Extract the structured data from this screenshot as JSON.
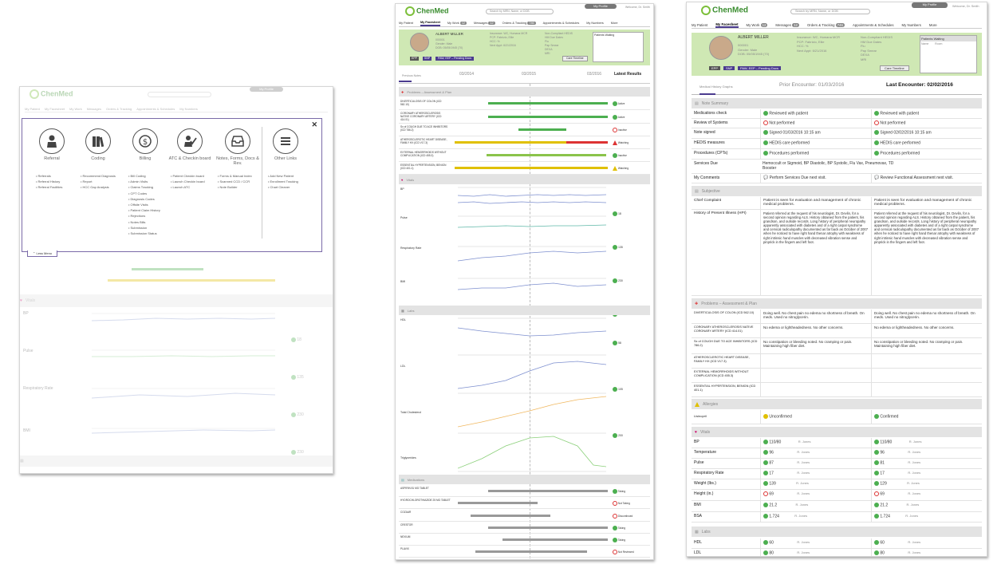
{
  "brand": {
    "logo_text": "ChenMed",
    "green": "#3a8d2f",
    "accent": "#4b3b8f"
  },
  "header": {
    "my_profile": "My Profile",
    "welcome": "Welcome, Dr. Smith",
    "sign_out": "Sign out",
    "search_placeholder": "Search by MRN, Name, or DOB"
  },
  "nav": {
    "tabs": [
      {
        "label": "My Patient"
      },
      {
        "label": "My Facesheet"
      },
      {
        "label": "My Work",
        "count": "12"
      },
      {
        "label": "Messages",
        "count": "12"
      },
      {
        "label": "Orders & Tracking",
        "count": "746"
      },
      {
        "label": "Appointments & Schedules"
      },
      {
        "label": "My Numbers"
      },
      {
        "label": "More"
      }
    ]
  },
  "menu_overlay": {
    "columns": [
      {
        "title": "Referral",
        "icon": "person-icon",
        "links": [
          "Referrals",
          "Referral History",
          "Referral Facilities"
        ]
      },
      {
        "title": "Coding",
        "icon": "books-icon",
        "links": [
          "Recommend Diagnosis",
          "Report",
          "HCC Gap Analysis"
        ]
      },
      {
        "title": "Billing",
        "icon": "dollar-icon",
        "links": [
          "Bill Coding",
          "Admin Visits",
          "Claims Tracking",
          "CPT Codes",
          "Diagnosis Codes",
          "Offsite Visits",
          "Patient Claim History",
          "Rejections",
          "Notes Bills",
          "Submission",
          "Submission Status"
        ]
      },
      {
        "title": "ATC & Checkin board",
        "icon": "checkin-icon",
        "links": [
          "Patient Checkin board",
          "Launch Checkin board",
          "Launch ATC"
        ]
      },
      {
        "title": "Notes, Forms, Docs & Rev.",
        "icon": "inbox-icon",
        "links": [
          "Forms & Manual Index",
          "Scanned CCD / CCR",
          "Note Builder"
        ]
      },
      {
        "title": "Other Links",
        "icon": "hamburger-icon",
        "links": [
          "Add New Patient",
          "Enrollment Tracking",
          "Chart Cleaner"
        ]
      }
    ],
    "less_menu": "Less Menu",
    "close": "✕"
  },
  "patient": {
    "name": "ALBERT MILLER",
    "id": "000001",
    "gender_label": "Gender:",
    "gender": "Male",
    "dob_label": "DOB:",
    "dob": "05/05/1945 (70)",
    "insurance_label": "Insurance:",
    "insurance": "WC, Humana MCR",
    "pcp_label": "PCP:",
    "pcp": "Fabrizio, Ellie",
    "hcc_label": "HCC:",
    "hcc": "%",
    "next_appt_label": "Next Appt:",
    "next_appt": "6/21/2016",
    "hedis_title": "Non-Compliant HEDIS",
    "hedis_items": [
      "HM Due Dates",
      "Flu",
      "Pap Smear",
      "DEXA",
      "MRI"
    ],
    "waiting_title": "Patients Waiting",
    "waiting_cols": [
      "Name",
      "Room"
    ],
    "tags": [
      "EPP",
      "SNP"
    ],
    "pending": "PAW, EEP – Pending Docs",
    "care_timeline": "Care Timeline"
  },
  "middle": {
    "tabs": [
      "Previous Notes"
    ],
    "dates": [
      "03/2014",
      "03/2015",
      "03/2016"
    ],
    "latest_results": "Latest Results",
    "problems_title": "Problems – Assessment & Plan",
    "problems": [
      {
        "name": "DIVERTICULOSIS OF COLON (ICD 562.10)",
        "status": "Active",
        "color": "#4caf50"
      },
      {
        "name": "CORONARY ATHEROSCLEROSIS NATIVE CORONARY ARTERY (ICD 414.01)",
        "status": "Active",
        "color": "#4caf50"
      },
      {
        "name": "Sx of COUGH DUE TO ACE INHIBITORS (ICD 786.2)",
        "status": "Inactive",
        "color": "#4caf50"
      },
      {
        "name": "ATHEROSCLEROTIC HEART DISEASE, FAMILY HX (ICD V17.3)",
        "status": "Watching",
        "color": "#d33"
      },
      {
        "name": "EXTERNAL HEMORRHOIDS WITHOUT COMPLICATION (ICD 455.3)",
        "status": "Inactive",
        "color": "#8bc34a"
      },
      {
        "name": "ESSENTIAL HYPERTENSION, BENIGN (ICD 401.1)",
        "status": "Watching",
        "color": "#e0c000"
      }
    ],
    "vitals_title": "Vitals",
    "vitals": [
      {
        "name": "BP",
        "value": "18"
      },
      {
        "name": "Pulse",
        "value": "135"
      },
      {
        "name": "Respiratory Rate",
        "value": "230"
      },
      {
        "name": "BMI",
        "value": "230"
      }
    ],
    "labs_title": "Labs",
    "labs": [
      {
        "name": "HDL",
        "value": "58"
      },
      {
        "name": "LDL",
        "value": "105"
      },
      {
        "name": "Total Cholesterol",
        "value": "200"
      },
      {
        "name": "Triglycerides",
        "value": "155"
      }
    ],
    "meds_title": "Medications",
    "meds": [
      {
        "name": "ASPIRIN 81 MG TABLET",
        "status": "Taking"
      },
      {
        "name": "HYDROCHLOROTHIAZIDE 25 MG TABLET",
        "status": "Not Taking"
      },
      {
        "name": "COZAAR",
        "status": "Discontinued"
      },
      {
        "name": "CRESTOR",
        "status": "Taking"
      },
      {
        "name": "NEXIUM",
        "status": "Taking"
      },
      {
        "name": "PLAVIX",
        "status": "Not Reviewed"
      }
    ]
  },
  "right": {
    "tab_graphs": "Medical History Graphs",
    "prior": "Prior Encounter: 01/03/2016",
    "last": "Last Encounter: 02/02/2016",
    "note_summary_title": "Note Summary",
    "note_rows": [
      {
        "label": "Medications check",
        "a": "Reviewed with patient",
        "b": "Reviewed with patient",
        "ia": "ok",
        "ib": "ok"
      },
      {
        "label": "Review of Systems",
        "a": "Not performed",
        "b": "Not performed",
        "ia": "no",
        "ib": "no"
      },
      {
        "label": "Note signed",
        "a": "Signed 01/03/2016 10:15 am",
        "b": "Signed 02/02/2016 10:15 am",
        "ia": "ok",
        "ib": "ok"
      },
      {
        "label": "HEDIS measures",
        "a": "HEDIS care performed",
        "b": "HEDIS care performed",
        "ia": "ok",
        "ib": "ok"
      },
      {
        "label": "Procedures (CPTs)",
        "a": "Procedures performed",
        "b": "Procedures performed",
        "ia": "ok",
        "ib": "ok"
      },
      {
        "label": "Services Due",
        "a": "Hemoccult or Sigmoid, BP Diastolic, BP Systolic, Flu Vax, Pneumovax, TD Booster",
        "b": "",
        "ia": "",
        "ib": ""
      },
      {
        "label": "My Comments",
        "a": "Perform Services Due next visit.",
        "b": "Review Functional Assessment next visit.",
        "ia": "",
        "ib": ""
      }
    ],
    "subjective_title": "Subjective",
    "chief_label": "Chief Complaint",
    "chief_text": "Patient is seen for evaluation and management of chronic medical problems.",
    "hpi_label": "History of Present Illness (HPI)",
    "hpi_text": "Patient referred at the request of his neurologist, Dr. Devlin, for a second opinion regarding ALS. History obtained from the patient, his grandson, and outside records. Long history of peripheral neuropathy apparently associated with diabetes and of a right carpal syndrome and cervical radiculopathy documented as far back as October of 2007 when he noticed to have right hand thenar atrophy with weakness of right intrinsic hand muscles with decreased vibration sense and pinprick in the fingers and left foot.",
    "problems_title": "Problems – Assessment & Plan",
    "problems": [
      {
        "label": "DIVERTICULOSIS OF COLON (ICD 562.10)",
        "a": "Doing well. No chest pain no edema no shortness of breath. On meds. Used no nitroglycerin.",
        "b": "Doing well. No chest pain no edema no shortness of breath. On meds. Used no nitroglycerin."
      },
      {
        "label": "CORONARY ATHEROSCLEROSIS NATIVE CORONARY ARTERY (ICD 414.01)",
        "a": "No edema or lightheadedness. No other concerns.",
        "b": "No edema or lightheadedness. No other concerns."
      },
      {
        "label": "Sx of COUGH DUE TO ACE INHIBITORS (ICD 786.2)",
        "a": "No constipation or bleeding noted. No cramping or pain. Maintaining high fiber diet.",
        "b": "No constipation or bleeding noted. No cramping or pain. Maintaining high fiber diet."
      },
      {
        "label": "ATHEROSCLEROTIC HEART DISEASE, FAMILY HX (ICD V17.3)",
        "a": "",
        "b": ""
      },
      {
        "label": "EXTERNAL HEMORRHOIDS WITHOUT COMPLICATION (ICD 455.3)",
        "a": "",
        "b": ""
      },
      {
        "label": "ESSENTIAL HYPERTENSION, BENIGN (ICD 401.1)",
        "a": "",
        "b": ""
      }
    ],
    "allergies_title": "Allergies",
    "allergy_label": "Lisinopril",
    "allergy_a": "Unconfirmed",
    "allergy_b": "Confirmed",
    "vitals_title": "Vitals",
    "vitals": [
      {
        "label": "BP",
        "a": "110/80",
        "b": "110/80",
        "who": "R. Jones"
      },
      {
        "label": "Temperature",
        "a": "96",
        "b": "96",
        "who": "R. Jones"
      },
      {
        "label": "Pulse",
        "a": "87",
        "b": "81",
        "who": "R. Jones"
      },
      {
        "label": "Respiratory Rate",
        "a": "17",
        "b": "17",
        "who": "R. Jones"
      },
      {
        "label": "Weight (lbs.)",
        "a": "139",
        "b": "129",
        "who": "R. Jones"
      },
      {
        "label": "Height (in.)",
        "a": "69",
        "b": "69",
        "who": "R. Jones"
      },
      {
        "label": "BMI",
        "a": "21.2",
        "b": "21.2",
        "who": "R. Jones"
      },
      {
        "label": "BSA",
        "a": "1.724",
        "b": "1.724",
        "who": "R. Jones"
      }
    ],
    "labs_title": "Labs",
    "labs": [
      {
        "label": "HDL",
        "a": "60",
        "b": "60",
        "who": "R. Jones"
      },
      {
        "label": "LDL",
        "a": "80",
        "b": "80",
        "who": "R. Jones"
      }
    ]
  }
}
